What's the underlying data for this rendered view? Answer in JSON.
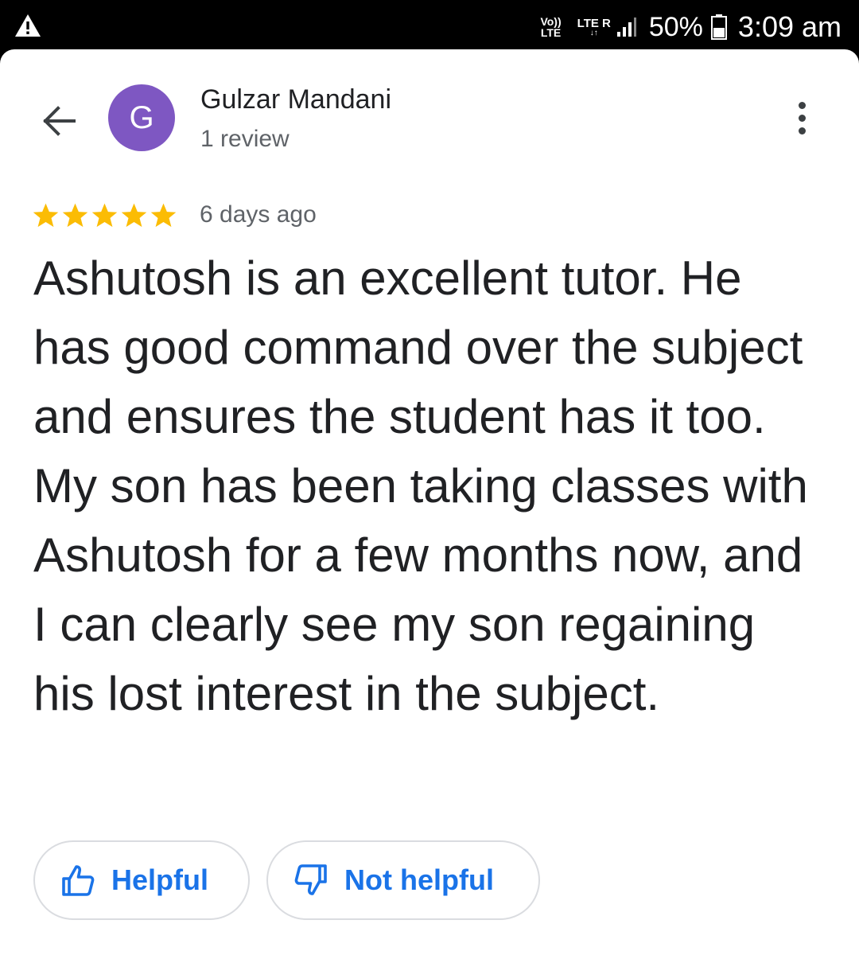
{
  "status_bar": {
    "volte_top": "Vo))",
    "volte_bottom": "LTE",
    "network_label": "LTE R",
    "network_arrows": "↓↑",
    "battery_percent": "50%",
    "time": "3:09 am",
    "icons": [
      "warning-icon",
      "signal-icon",
      "battery-icon"
    ]
  },
  "header": {
    "back_icon": "arrow-left-icon",
    "avatar_letter": "G",
    "avatar_color": "#7e57c2",
    "reviewer_name": "Gulzar Mandani",
    "review_count": "1 review",
    "menu_icon": "more-vertical-icon"
  },
  "review": {
    "rating": 5,
    "rating_max": 5,
    "star_color": "#fbbc04",
    "date": "6 days ago",
    "text": "Ashutosh is an excellent tutor. He has good command over the subject and ensures the student has it too. My son has been taking classes with Ashutosh for a few months now, and I can clearly see my son regaining his lost interest in the subject."
  },
  "actions": {
    "helpful_label": "Helpful",
    "helpful_icon": "thumb-up-icon",
    "not_helpful_label": "Not helpful",
    "not_helpful_icon": "thumb-down-icon",
    "accent_color": "#1a73e8"
  }
}
